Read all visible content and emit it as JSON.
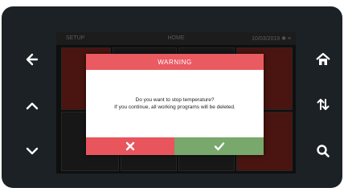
{
  "topbar": {
    "left_text": "SETUP",
    "title": "HOME",
    "right_text": "10/03/2019 ✱ ≡"
  },
  "side_buttons": {
    "left": [
      "left-arrow-icon",
      "chevron-up-icon",
      "chevron-down-icon"
    ],
    "right": [
      "home-icon",
      "sort-arrows-icon",
      "search-icon"
    ]
  },
  "dialog": {
    "title": "WARNING",
    "message_line1": "Do you want to stop temperature?",
    "message_line2": "If you continue, all working programs will be deleted.",
    "cancel_icon": "close-icon",
    "confirm_icon": "check-icon"
  },
  "colors": {
    "device_frame": "#1b2125",
    "dialog_header": "#ea5a61",
    "cancel_button": "#e9555d",
    "confirm_button": "#78a86b"
  }
}
